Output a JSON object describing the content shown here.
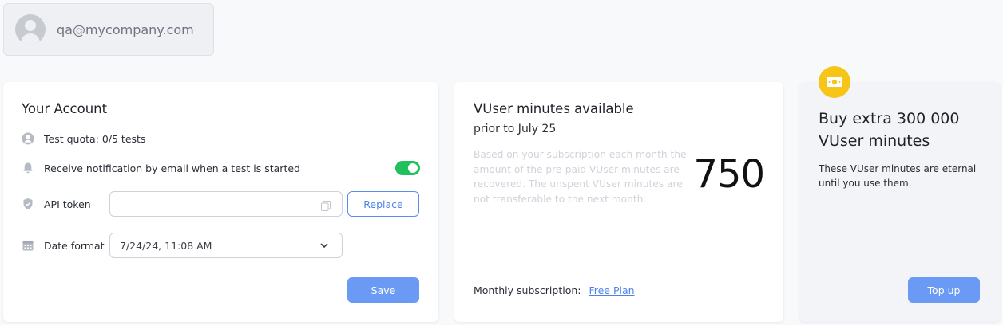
{
  "user": {
    "email": "qa@mycompany.com",
    "avatar_icon": "user-avatar-icon"
  },
  "account": {
    "title": "Your Account",
    "quota_label": "Test quota: 0/5 tests",
    "notification_label": "Receive notification by email when a test is started",
    "notification_enabled": true,
    "api_token_label": "API token",
    "api_token_value": "",
    "replace_label": "Replace",
    "date_format_label": "Date format",
    "date_format_value": "7/24/24, 11:08 AM",
    "save_label": "Save"
  },
  "minutes": {
    "title": "VUser minutes available",
    "subtitle": "prior to July 25",
    "description": "Based on your subscription each month the amount of the pre-paid VUser minutes are recovered. The unspent VUser minutes are not transferable to the next month.",
    "value": "750",
    "subscription_label": "Monthly subscription:",
    "plan_label": "Free Plan"
  },
  "buy": {
    "icon": "cash-icon",
    "title": "Buy extra 300 000 VUser minutes",
    "description": "These VUser minutes are eternal until you use them.",
    "topup_label": "Top up"
  },
  "colors": {
    "accent": "#6b9af4",
    "link": "#4f82e8",
    "toggle_on": "#20c05c",
    "coin": "#f7c517"
  }
}
